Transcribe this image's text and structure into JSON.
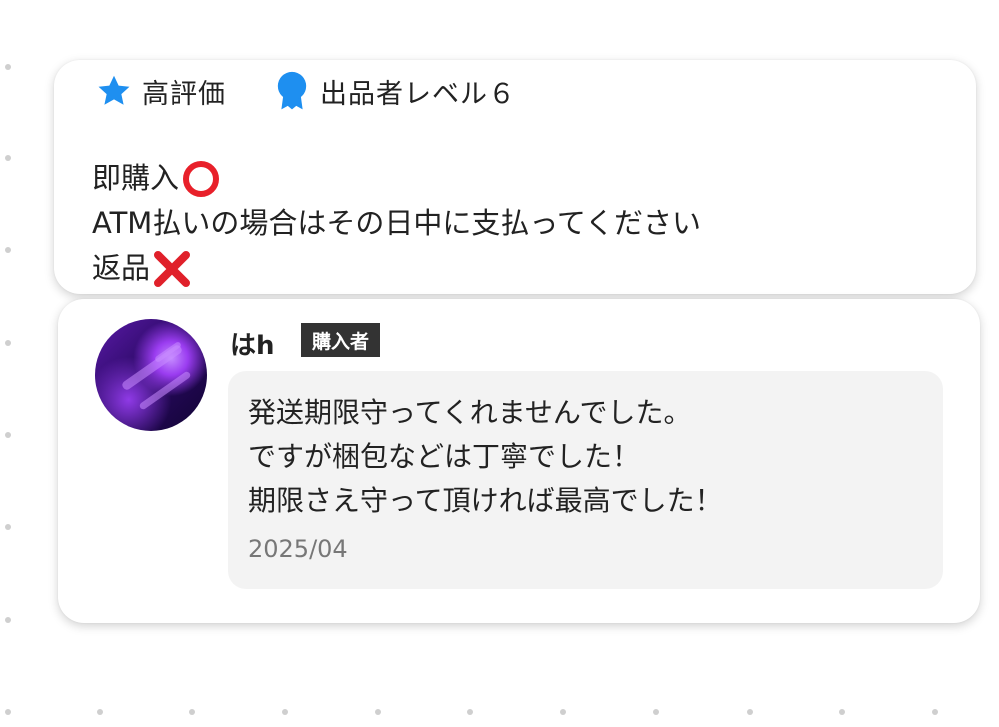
{
  "seller_profile": {
    "badges": [
      {
        "icon": "star-icon",
        "label": "高評価"
      },
      {
        "icon": "medal-icon",
        "label": "出品者レベル６"
      }
    ],
    "description_lines": [
      {
        "text": "即購入",
        "mark": "circle-mark-icon"
      },
      {
        "text": "ATM払いの場合はその日中に支払ってください",
        "mark": ""
      },
      {
        "text": "返品",
        "mark": "cross-mark-icon"
      }
    ]
  },
  "review": {
    "reviewer_name": "はh",
    "role_badge": "購入者",
    "message_lines": [
      "発送期限守ってくれませんでした。",
      "ですが梱包などは丁寧でした！",
      "期限さえ守って頂ければ最高でした！"
    ],
    "date": "2025/04"
  },
  "colors": {
    "accent_blue": "#1e8ff0",
    "circle_red": "#e8202a",
    "cross_red": "#e0202a",
    "role_badge_bg": "#333333",
    "bubble_bg": "#f3f3f3"
  }
}
